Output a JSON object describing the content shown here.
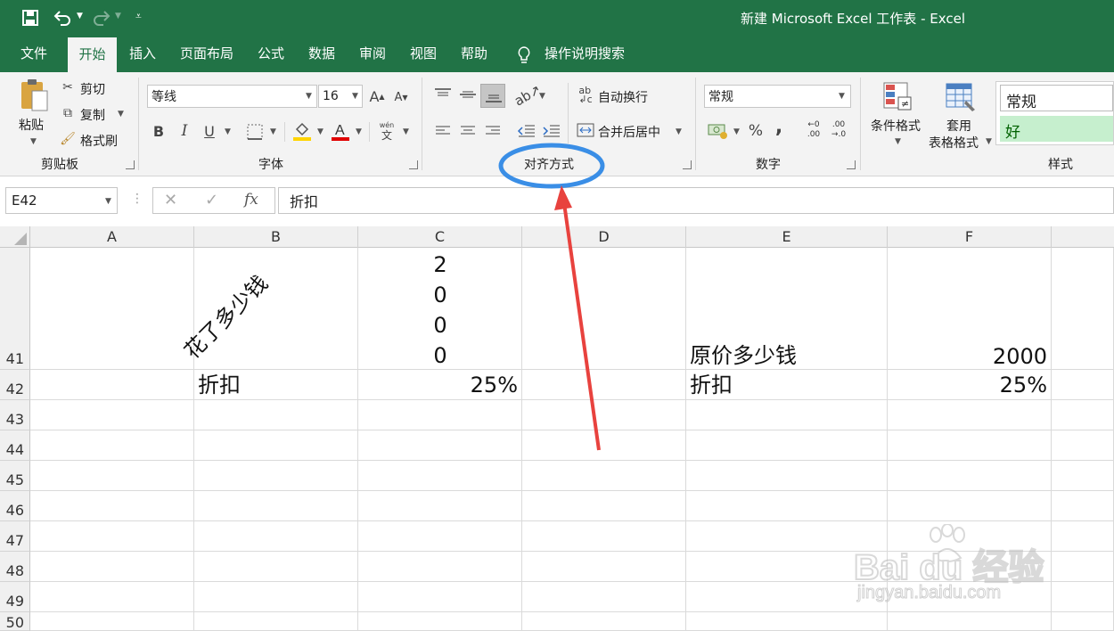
{
  "title_bar": {
    "title": "新建 Microsoft Excel 工作表 - Excel"
  },
  "tabs": [
    "文件",
    "开始",
    "插入",
    "页面布局",
    "公式",
    "数据",
    "审阅",
    "视图",
    "帮助"
  ],
  "tell_me": "操作说明搜索",
  "clipboard": {
    "paste": "粘贴",
    "cut": "剪切",
    "copy": "复制",
    "format_painter": "格式刷",
    "label": "剪贴板"
  },
  "font": {
    "name": "等线",
    "size": "16",
    "bold": "B",
    "italic": "I",
    "underline": "U",
    "label": "字体",
    "grow": "A",
    "shrink": "A",
    "phonetic_top": "wén",
    "phonetic_bottom": "文"
  },
  "alignment": {
    "wrap": "自动换行",
    "merge": "合并后居中",
    "label": "对齐方式"
  },
  "number": {
    "format": "常规",
    "percent": "%",
    "comma": ",",
    "label": "数字",
    "inc_top": "←0",
    "inc_bottom": ".00",
    "dec_top": ".00",
    "dec_bottom": "→.0"
  },
  "styles": {
    "conditional": "条件格式",
    "table_line1": "套用",
    "table_line2": "表格格式",
    "normal": "常规",
    "good": "好",
    "label": "样式"
  },
  "formula_bar": {
    "name_box": "E42",
    "content": "折扣",
    "fx": "fx"
  },
  "columns": [
    "A",
    "B",
    "C",
    "D",
    "E",
    "F"
  ],
  "rows": [
    "41",
    "42",
    "43",
    "44",
    "45",
    "46",
    "47",
    "48",
    "49",
    "50"
  ],
  "cells": {
    "B41": "花了多少钱",
    "C41": [
      "2",
      "0",
      "0",
      "0"
    ],
    "E41": "原价多少钱",
    "F41": "2000",
    "B42": "折扣",
    "C42": "25%",
    "E42": "折扣",
    "F42": "25%"
  },
  "watermark": {
    "brand": "Bai du 经验",
    "url": "jingyan.baidu.com"
  },
  "colors": {
    "excel_green": "#217346",
    "annotation_blue": "#3a8ee6",
    "annotation_red": "#e8423e",
    "good_fill": "#c6efce",
    "good_text": "#006100"
  }
}
